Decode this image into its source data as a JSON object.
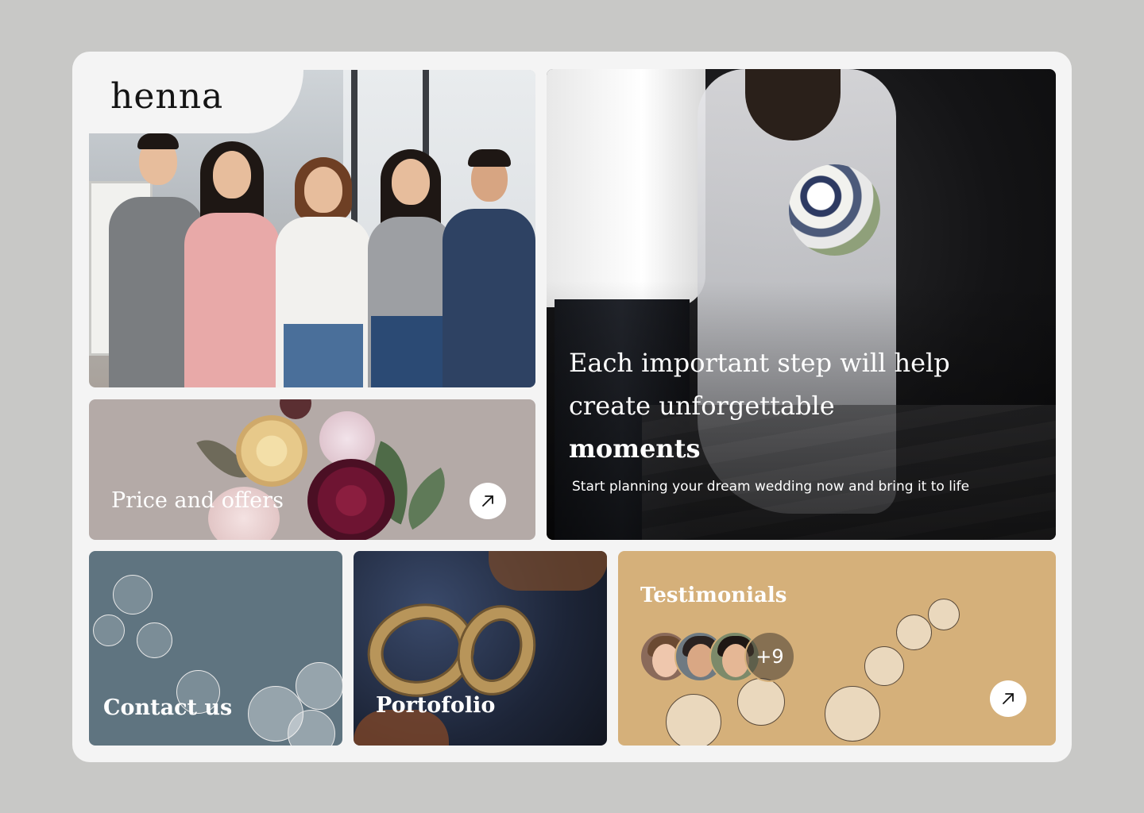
{
  "brand": {
    "logo_text": "henna"
  },
  "hero": {
    "headline_line1": "Each important step will help",
    "headline_line2": "create unforgettable",
    "headline_bold": "moments",
    "subtext": "Start planning your dream wedding now and bring it to life"
  },
  "cards": {
    "price_label": "Price and offers",
    "contact_label": "Contact us",
    "portfolio_label": "Portofolio",
    "testimonials_label": "Testimonials",
    "testimonials_more": "+9"
  },
  "icons": {
    "arrow": "arrow-up-right-icon"
  },
  "colors": {
    "page_bg": "#c8c8c6",
    "frame_bg": "#f4f4f4",
    "price_card": "#b4aaa7",
    "contact_card": "#5f7480",
    "testimonials_card": "#d5b07a"
  }
}
